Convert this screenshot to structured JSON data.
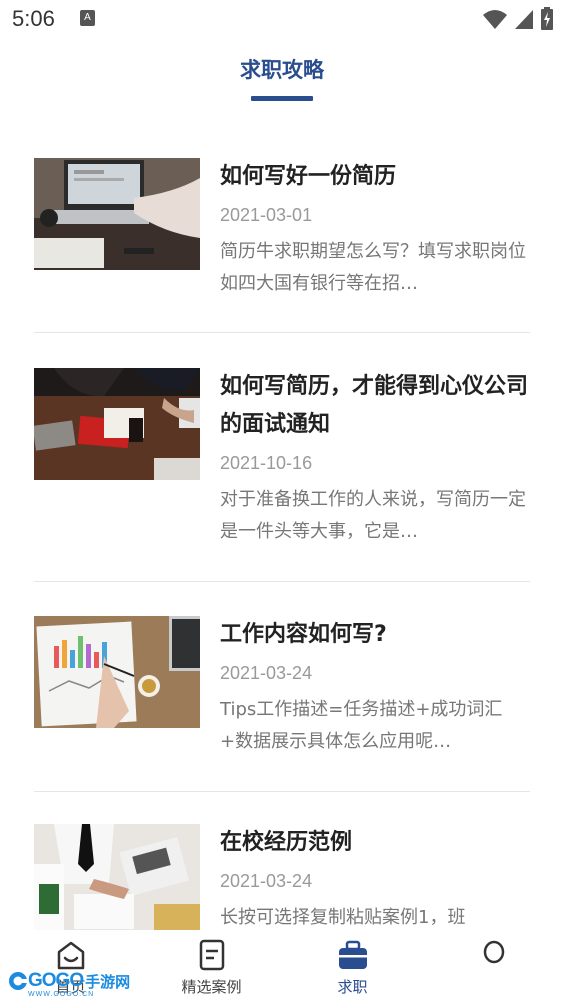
{
  "status_bar": {
    "time": "5:06",
    "notification_letter": "A"
  },
  "header": {
    "title": "求职攻略"
  },
  "articles": [
    {
      "title": "如何写好一份简历",
      "date": "2021-03-01",
      "summary": "简历牛求职期望怎么写？填写求职岗位如四大国有银行等在招…"
    },
    {
      "title": "如何写简历，才能得到心仪公司的面试通知",
      "date": "2021-10-16",
      "summary": "对于准备换工作的人来说，写简历一定是一件头等大事，它是…"
    },
    {
      "title": "工作内容如何写?",
      "date": "2021-03-24",
      "summary": "Tips工作描述=任务描述+成功词汇+数据展示具体怎么应用呢…"
    },
    {
      "title": "在校经历范例",
      "date": "2021-03-24",
      "summary": "长按可选择复制粘贴案例1，班"
    }
  ],
  "tabs": [
    {
      "label": "首页",
      "icon": "home-icon"
    },
    {
      "label": "精选案例",
      "icon": "document-icon"
    },
    {
      "label": "求职",
      "icon": "briefcase-icon"
    },
    {
      "label": "",
      "icon": "profile-icon"
    }
  ],
  "active_tab": "求职",
  "watermark": {
    "logo": "GOGO",
    "text": "手游网",
    "sub": "WWW.GOGO.CN"
  },
  "colors": {
    "accent": "#2a4d8f",
    "title_text": "#222222",
    "date_text": "#999999",
    "summary_text": "#777777",
    "watermark": "#1a8be0"
  }
}
